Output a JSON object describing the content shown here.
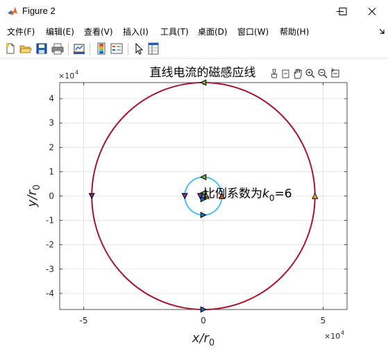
{
  "window": {
    "title": "Figure 2"
  },
  "menu": [
    "文件(F)",
    "编辑(E)",
    "查看(V)",
    "插入(I)",
    "工具(T)",
    "桌面(D)",
    "窗口(W)",
    "帮助(H)"
  ],
  "toolbar": {
    "buttons": [
      "new-figure",
      "open-file",
      "save",
      "print",
      "link-plot",
      "insert-colorbar",
      "insert-legend",
      "edit-plot",
      "property-inspector"
    ]
  },
  "axes_toolbar": [
    "brush",
    "data-cursor",
    "rotate",
    "pan",
    "zoom-in",
    "zoom-out",
    "restore-view"
  ],
  "chart_data": {
    "type": "line",
    "title": "直线电流的磁感应线",
    "xlabel": "x/r0",
    "ylabel": "y/r0",
    "x_exponent_label": "×10",
    "x_exponent": "4",
    "y_exponent_label": "×10",
    "y_exponent": "4",
    "xlim": [
      -60000,
      60000
    ],
    "ylim": [
      -46600,
      46600
    ],
    "xticks": [
      -50000,
      0,
      50000
    ],
    "xtick_labels": [
      "-5",
      "0",
      "5"
    ],
    "yticks": [
      -40000,
      -30000,
      -20000,
      -10000,
      0,
      10000,
      20000,
      30000,
      40000
    ],
    "ytick_labels": [
      "-4",
      "-3",
      "-2",
      "-1",
      "0",
      "1",
      "2",
      "3",
      "4"
    ],
    "grid": true,
    "annotation": {
      "text_prefix": "比例系数为",
      "k": "k",
      "sub": "0",
      "suffix": "=6",
      "x": 0,
      "y": 0
    },
    "series": [
      {
        "radius": 46600,
        "color": "#a2142f"
      },
      {
        "radius": 7770,
        "color": "#4dbeee"
      },
      {
        "radius": 1300,
        "color": "#7e2f8e"
      },
      {
        "radius": 500,
        "color": "#0072bd"
      }
    ],
    "markers": [
      {
        "x": 0,
        "y": 46600,
        "dir": "left",
        "color": "#77ac30"
      },
      {
        "x": 0,
        "y": -46600,
        "dir": "right",
        "color": "#0072bd"
      },
      {
        "x": -46600,
        "y": 0,
        "dir": "down",
        "color": "#7e2f8e"
      },
      {
        "x": 46600,
        "y": 0,
        "dir": "up",
        "color": "#edb120"
      },
      {
        "x": 0,
        "y": 7770,
        "dir": "left",
        "color": "#77ac30"
      },
      {
        "x": 0,
        "y": -7770,
        "dir": "right",
        "color": "#0072bd"
      },
      {
        "x": -7770,
        "y": 0,
        "dir": "down",
        "color": "#7e2f8e"
      },
      {
        "x": 7770,
        "y": 0,
        "dir": "up",
        "color": "#d95319"
      },
      {
        "x": 0,
        "y": 1300,
        "dir": "left",
        "color": "#77ac30"
      },
      {
        "x": 0,
        "y": -1300,
        "dir": "right",
        "color": "#0072bd"
      },
      {
        "x": -1300,
        "y": 0,
        "dir": "down",
        "color": "#7e2f8e"
      },
      {
        "x": 1300,
        "y": 0,
        "dir": "up",
        "color": "#edb120"
      }
    ]
  }
}
